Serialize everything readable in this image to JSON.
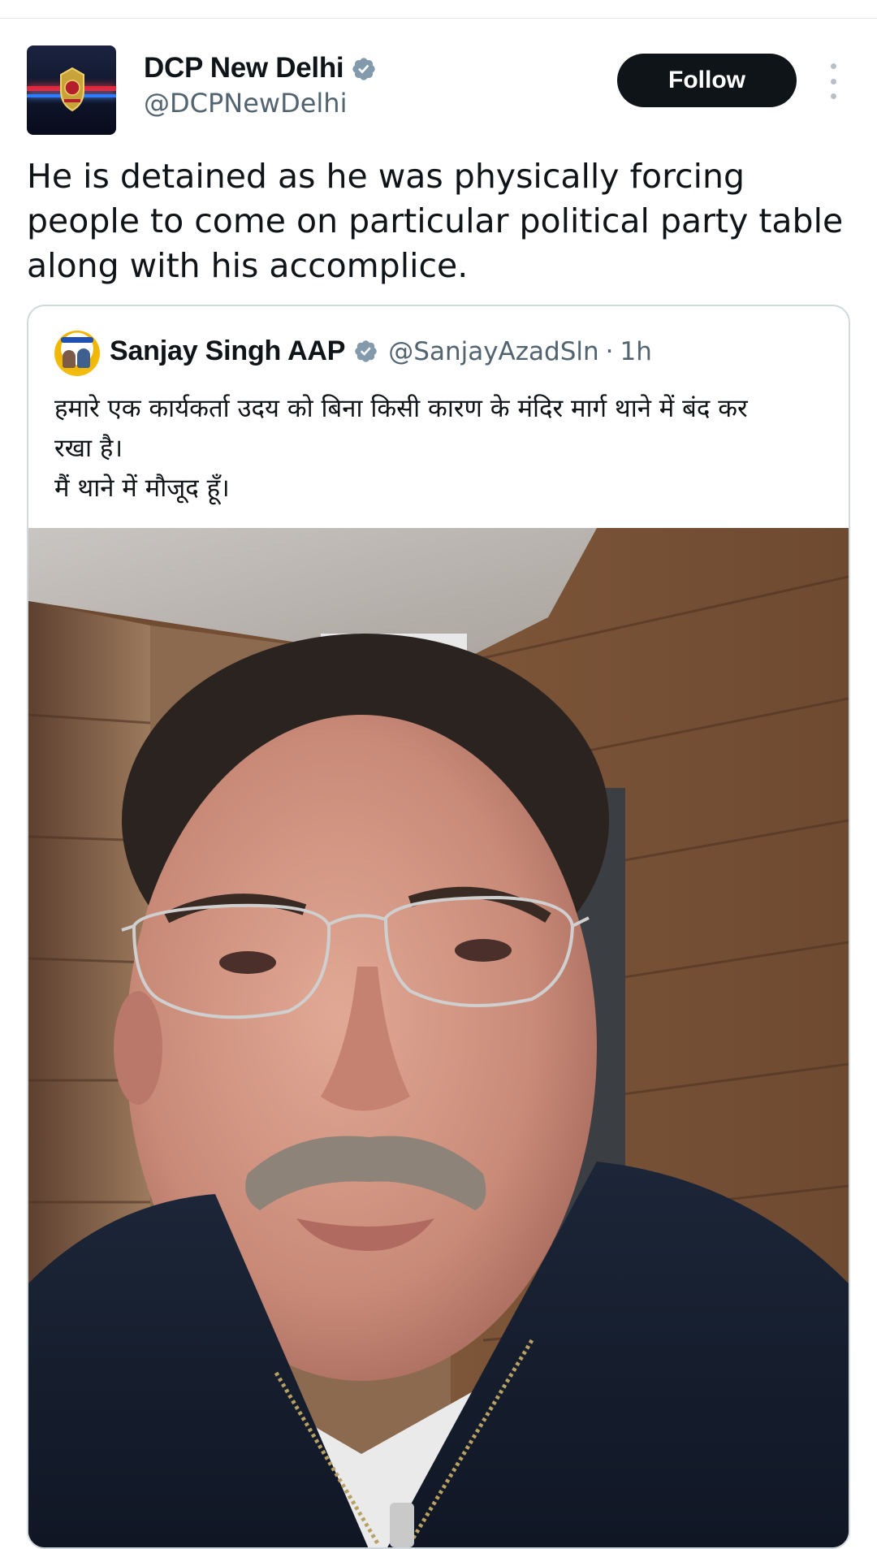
{
  "tweet": {
    "author": {
      "display_name": "DCP New Delhi",
      "handle": "@DCPNewDelhi",
      "verified": true,
      "avatar": "delhi-police-emblem-logo"
    },
    "follow_label": "Follow",
    "more_icon": "more-vertical-icon",
    "text": "He is detained as he was physically forcing  people to come on particular political party table along with his accomplice.",
    "quoted": {
      "author": {
        "display_name": "Sanjay Singh AAP",
        "handle": "@SanjayAzadSln",
        "verified": true,
        "avatar": "aap-party-avatar"
      },
      "separator": "·",
      "time": "1h",
      "text_lines": [
        "हमारे एक कार्यकर्ता उदय को बिना किसी कारण के मंदिर मार्ग थाने में बंद कर",
        "रखा है।",
        "मैं थाने में मौजूद हूँ।"
      ],
      "media": "selfie-photo"
    }
  },
  "colors": {
    "text_primary": "#0f1419",
    "text_secondary": "#536471",
    "verified_badge": "#829aab",
    "follow_button_bg": "#0f1419",
    "follow_button_text": "#ffffff",
    "card_border": "#cfd9de"
  }
}
